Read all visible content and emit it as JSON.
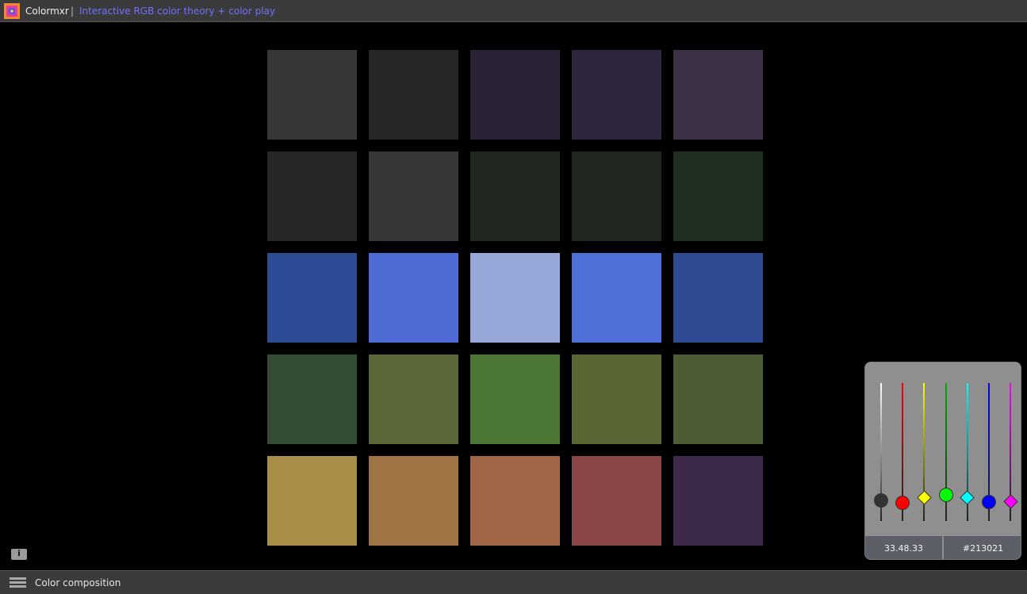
{
  "header": {
    "app_name": "Colormxr",
    "separator": "|",
    "tagline": "Interactive RGB color theory + color play"
  },
  "grid": {
    "rows": [
      [
        "#373737",
        "#272727",
        "#2c2235",
        "#2d243d",
        "#3d3147"
      ],
      [
        "#262626",
        "#373737",
        "#222821",
        "#202720",
        "#212f22"
      ],
      [
        "#2d4a94",
        "#4f6bd5",
        "#97a7d8",
        "#4f6fd9",
        "#2f4b94"
      ],
      [
        "#344c33",
        "#5b6737",
        "#4b7634",
        "#5b6635",
        "#4c5c33"
      ],
      [
        "#a88d47",
        "#a07445",
        "#a16646",
        "#8a4646",
        "#3d2a4b"
      ]
    ]
  },
  "sliders": [
    {
      "name": "white",
      "color": "#ffffff",
      "shape": "circle",
      "knob": "#333333",
      "level": 0.15
    },
    {
      "name": "red",
      "color": "#ff0000",
      "shape": "circle",
      "knob": "#ff0000",
      "level": 0.13
    },
    {
      "name": "yellow",
      "color": "#ffff00",
      "shape": "diamond",
      "knob": "#ffff00",
      "level": 0.17
    },
    {
      "name": "green",
      "color": "#00aa00",
      "shape": "circle",
      "knob": "#00ff00",
      "level": 0.19
    },
    {
      "name": "cyan",
      "color": "#00ffff",
      "shape": "diamond",
      "knob": "#00ffff",
      "level": 0.17
    },
    {
      "name": "blue",
      "color": "#0000ff",
      "shape": "circle",
      "knob": "#0000ff",
      "level": 0.14
    },
    {
      "name": "magenta",
      "color": "#ff00ff",
      "shape": "diamond",
      "knob": "#ff00ff",
      "level": 0.14
    }
  ],
  "readout": {
    "rgb": "33.48.33",
    "hex": "#213021"
  },
  "info_button": {
    "label": "i"
  },
  "footer": {
    "menu_icon": "hamburger-menu-icon",
    "label": "Color composition"
  }
}
